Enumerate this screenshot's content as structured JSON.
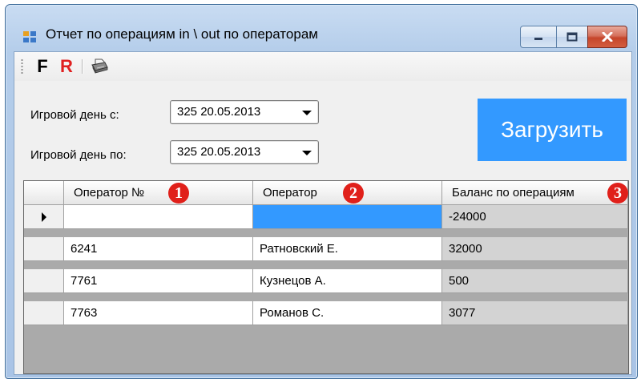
{
  "window": {
    "title": "Отчет по операциям in \\ out по операторам"
  },
  "toolbar": {
    "f_label": "F",
    "r_label": "R",
    "print_icon": "printer-icon"
  },
  "filters": {
    "from_label": "Игровой день с:",
    "from_value": "325 20.05.2013",
    "to_label": "Игровой день по:",
    "to_value": "325 20.05.2013"
  },
  "load_button": {
    "label": "Загрузить",
    "color": "#3399ff"
  },
  "grid": {
    "columns": [
      "Оператор №",
      "Оператор",
      "Баланс по операциям"
    ],
    "badges": [
      "1",
      "2",
      "3"
    ],
    "rows": [
      [
        "",
        "",
        "-24000"
      ],
      [
        "6241",
        "Ратновский Е.",
        "32000"
      ],
      [
        "7761",
        "Кузнецов А.",
        "500"
      ],
      [
        "7763",
        "Романов С.",
        "3077"
      ]
    ],
    "selected_color": "#3399ff",
    "badge_color": "#e0201a"
  }
}
